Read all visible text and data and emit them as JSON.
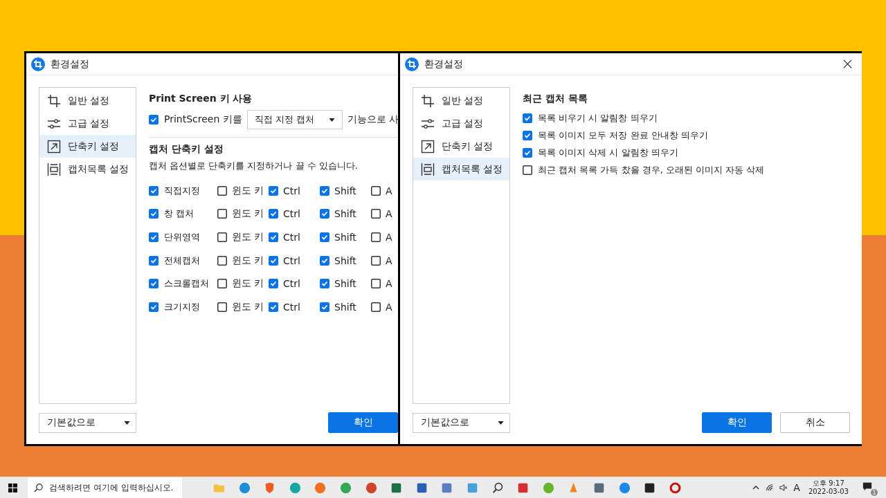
{
  "windows": [
    {
      "kind": "shortcuts",
      "title": "환경설정",
      "sidebar": [
        {
          "label": "일반 설정",
          "selected": false
        },
        {
          "label": "고급 설정",
          "selected": false
        },
        {
          "label": "단축키 설정",
          "selected": true
        },
        {
          "label": "캡처목록 설정",
          "selected": false
        }
      ],
      "printscreen": {
        "title": "Print Screen 키 사용",
        "checked": true,
        "label": "PrintScreen 키를",
        "select": "직접 지정 캡처",
        "after": "기능으로 사"
      },
      "shortcuts": {
        "title": "캡처 단축키 설정",
        "description": "캡처 옵션별로 단축키를 지정하거나 끌 수 있습니다.",
        "rows": [
          {
            "name": "직접지정",
            "checked": true,
            "keys": [
              {
                "label": "윈도 키",
                "checked": false
              },
              {
                "label": "Ctrl",
                "checked": true
              },
              {
                "label": "Shift",
                "checked": true
              },
              {
                "label": "A",
                "checked": false
              }
            ]
          },
          {
            "name": "창 캡처",
            "checked": true,
            "keys": [
              {
                "label": "윈도 키",
                "checked": false
              },
              {
                "label": "Ctrl",
                "checked": true
              },
              {
                "label": "Shift",
                "checked": true
              },
              {
                "label": "A",
                "checked": false
              }
            ]
          },
          {
            "name": "단위영역",
            "checked": true,
            "keys": [
              {
                "label": "윈도 키",
                "checked": false
              },
              {
                "label": "Ctrl",
                "checked": true
              },
              {
                "label": "Shift",
                "checked": true
              },
              {
                "label": "A",
                "checked": false
              }
            ]
          },
          {
            "name": "전체캡처",
            "checked": true,
            "keys": [
              {
                "label": "윈도 키",
                "checked": false
              },
              {
                "label": "Ctrl",
                "checked": true
              },
              {
                "label": "Shift",
                "checked": true
              },
              {
                "label": "A",
                "checked": false
              }
            ]
          },
          {
            "name": "스크롤캡처",
            "checked": true,
            "keys": [
              {
                "label": "윈도 키",
                "checked": false
              },
              {
                "label": "Ctrl",
                "checked": true
              },
              {
                "label": "Shift",
                "checked": true
              },
              {
                "label": "A",
                "checked": false
              }
            ]
          },
          {
            "name": "크기지정",
            "checked": true,
            "keys": [
              {
                "label": "윈도 키",
                "checked": false
              },
              {
                "label": "Ctrl",
                "checked": true
              },
              {
                "label": "Shift",
                "checked": true
              },
              {
                "label": "A",
                "checked": false
              }
            ]
          }
        ]
      },
      "reset": "기본값으로",
      "buttons": [
        {
          "label": "확인",
          "kind": "primary"
        }
      ]
    },
    {
      "kind": "capture_list",
      "title": "환경설정",
      "sidebar": [
        {
          "label": "일반 설정",
          "selected": false
        },
        {
          "label": "고급 설정",
          "selected": false
        },
        {
          "label": "단축키 설정",
          "selected": false
        },
        {
          "label": "캡처목록 설정",
          "selected": true
        }
      ],
      "section": {
        "title": "최근 캡처 목록",
        "options": [
          {
            "label": "목록 비우기 시 알림창 띄우기",
            "checked": true
          },
          {
            "label": "목록 이미지 모두 저장 완료 안내창 띄우기",
            "checked": true
          },
          {
            "label": "목록 이미지 삭제 시 알림창 띄우기",
            "checked": true
          },
          {
            "label": "최근 캡처 목록 가득 찼을 경우, 오래된 이미지 자동 삭제",
            "checked": false
          }
        ]
      },
      "reset": "기본값으로",
      "buttons": [
        {
          "label": "확인",
          "kind": "primary"
        },
        {
          "label": "취소",
          "kind": "secondary"
        }
      ]
    }
  ],
  "taskbar": {
    "search_placeholder": "검색하려면 여기에 입력하십시오.",
    "ime": "A",
    "time": "오후 9:17",
    "date": "2022-03-03",
    "notifications": "1"
  }
}
